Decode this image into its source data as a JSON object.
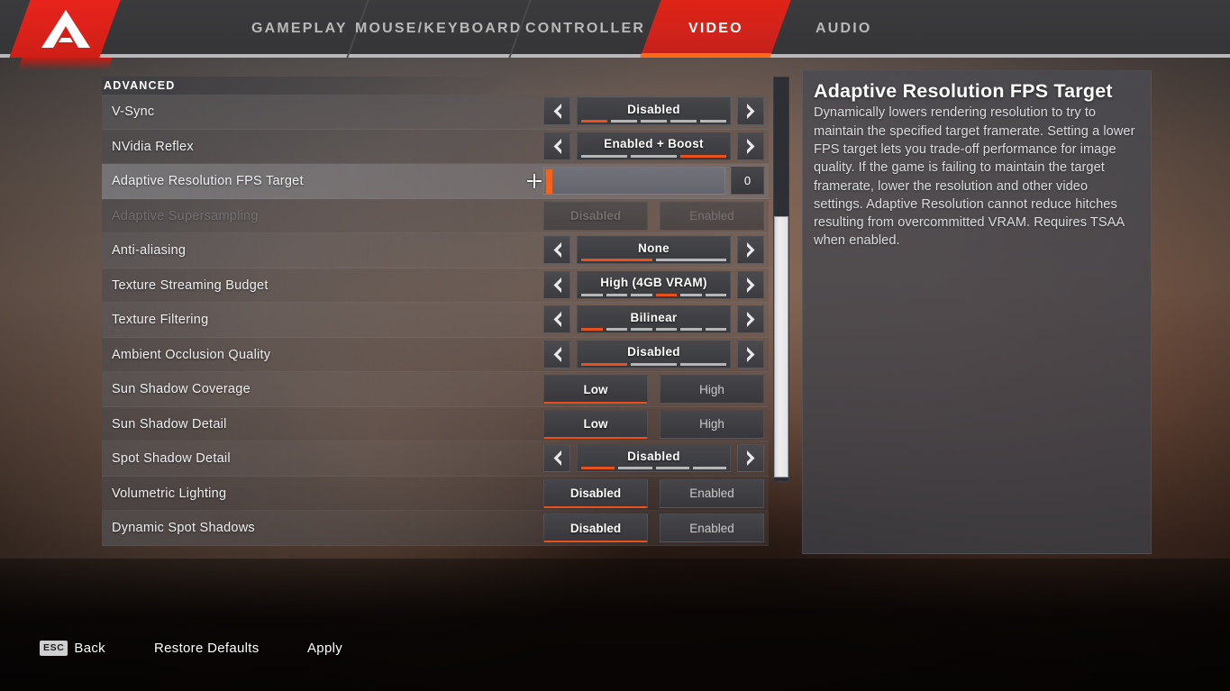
{
  "app": {
    "logo_icon": "apex-logo-icon"
  },
  "tabs": [
    {
      "id": "gameplay",
      "label": "GAMEPLAY",
      "active": false
    },
    {
      "id": "mouse-keyboard",
      "label": "MOUSE/KEYBOARD",
      "active": false
    },
    {
      "id": "controller",
      "label": "CONTROLLER",
      "active": false
    },
    {
      "id": "video",
      "label": "VIDEO",
      "active": true
    },
    {
      "id": "audio",
      "label": "AUDIO",
      "active": false
    }
  ],
  "settings": {
    "section_header": "ADVANCED",
    "rows": [
      {
        "label": "V-Sync",
        "type": "selector",
        "value": "Disabled",
        "segments": 5,
        "active_segment": 1,
        "disabled": false,
        "selected": false
      },
      {
        "label": "NVidia Reflex",
        "type": "selector",
        "value": "Enabled + Boost",
        "segments": 3,
        "active_segment": 3,
        "disabled": false,
        "selected": false
      },
      {
        "label": "Adaptive Resolution FPS Target",
        "type": "slider",
        "value": "0",
        "min": 0,
        "max": 100,
        "disabled": false,
        "selected": true
      },
      {
        "label": "Adaptive Supersampling",
        "type": "toggle",
        "options": [
          "Disabled",
          "Enabled"
        ],
        "value": "Disabled",
        "disabled": true,
        "selected": false
      },
      {
        "label": "Anti-aliasing",
        "type": "selector",
        "value": "None",
        "segments": 2,
        "active_segment": 1,
        "disabled": false,
        "selected": false
      },
      {
        "label": "Texture Streaming Budget",
        "type": "selector",
        "value": "High (4GB VRAM)",
        "segments": 6,
        "active_segment": 4,
        "disabled": false,
        "selected": false
      },
      {
        "label": "Texture Filtering",
        "type": "selector",
        "value": "Bilinear",
        "segments": 6,
        "active_segment": 1,
        "disabled": false,
        "selected": false
      },
      {
        "label": "Ambient Occlusion Quality",
        "type": "selector",
        "value": "Disabled",
        "segments": 3,
        "active_segment": 1,
        "disabled": false,
        "selected": false
      },
      {
        "label": "Sun Shadow Coverage",
        "type": "toggle",
        "options": [
          "Low",
          "High"
        ],
        "value": "Low",
        "disabled": false,
        "selected": false
      },
      {
        "label": "Sun Shadow Detail",
        "type": "toggle",
        "options": [
          "Low",
          "High"
        ],
        "value": "Low",
        "disabled": false,
        "selected": false
      },
      {
        "label": "Spot Shadow Detail",
        "type": "selector",
        "value": "Disabled",
        "segments": 4,
        "active_segment": 1,
        "disabled": false,
        "selected": false
      },
      {
        "label": "Volumetric Lighting",
        "type": "toggle",
        "options": [
          "Disabled",
          "Enabled"
        ],
        "value": "Disabled",
        "disabled": false,
        "selected": false
      },
      {
        "label": "Dynamic Spot Shadows",
        "type": "toggle",
        "options": [
          "Disabled",
          "Enabled"
        ],
        "value": "Disabled",
        "disabled": false,
        "selected": false
      }
    ],
    "prev_icon": "chevron-left-icon",
    "next_icon": "chevron-right-icon"
  },
  "description": {
    "title": "Adaptive Resolution FPS Target",
    "body": "Dynamically lowers rendering resolution to try to maintain the specified target framerate. Setting a lower FPS target lets you trade-off performance for image quality. If the game is failing to maintain the target framerate, lower the resolution and other video settings. Adaptive Resolution cannot reduce hitches resulting from overcommitted VRAM. Requires TSAA when enabled."
  },
  "bottom_bar": {
    "back_key": "ESC",
    "back_label": "Back",
    "restore_label": "Restore Defaults",
    "apply_label": "Apply"
  },
  "colors": {
    "accent_orange": "#e8511e",
    "brand_red": "#e0231a",
    "panel_gray": "#56565a",
    "selected_row": "#7d7d82"
  }
}
